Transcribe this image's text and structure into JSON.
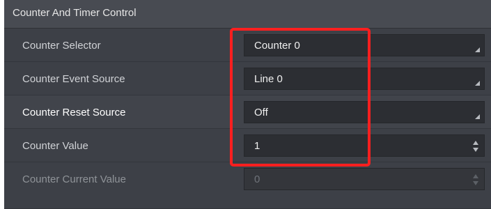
{
  "section": {
    "title": "Counter And Timer Control"
  },
  "rows": [
    {
      "label": "Counter Selector",
      "value": "Counter 0",
      "control": "dropdown"
    },
    {
      "label": "Counter Event Source",
      "value": "Line 0",
      "control": "dropdown"
    },
    {
      "label": "Counter Reset Source",
      "value": "Off",
      "control": "dropdown"
    },
    {
      "label": "Counter Value",
      "value": "1",
      "control": "spinbox"
    },
    {
      "label": "Counter Current Value",
      "value": "0",
      "control": "spinbox",
      "disabled": true
    }
  ],
  "icons": {
    "dropdown": "chevron-corner-icon",
    "spinbox": "up-down-arrows-icon"
  },
  "colors": {
    "panel_bg": "#3a3d44",
    "header_bg": "#484b52",
    "field_bg": "#2c2e33",
    "highlight": "#ff1f1f"
  }
}
